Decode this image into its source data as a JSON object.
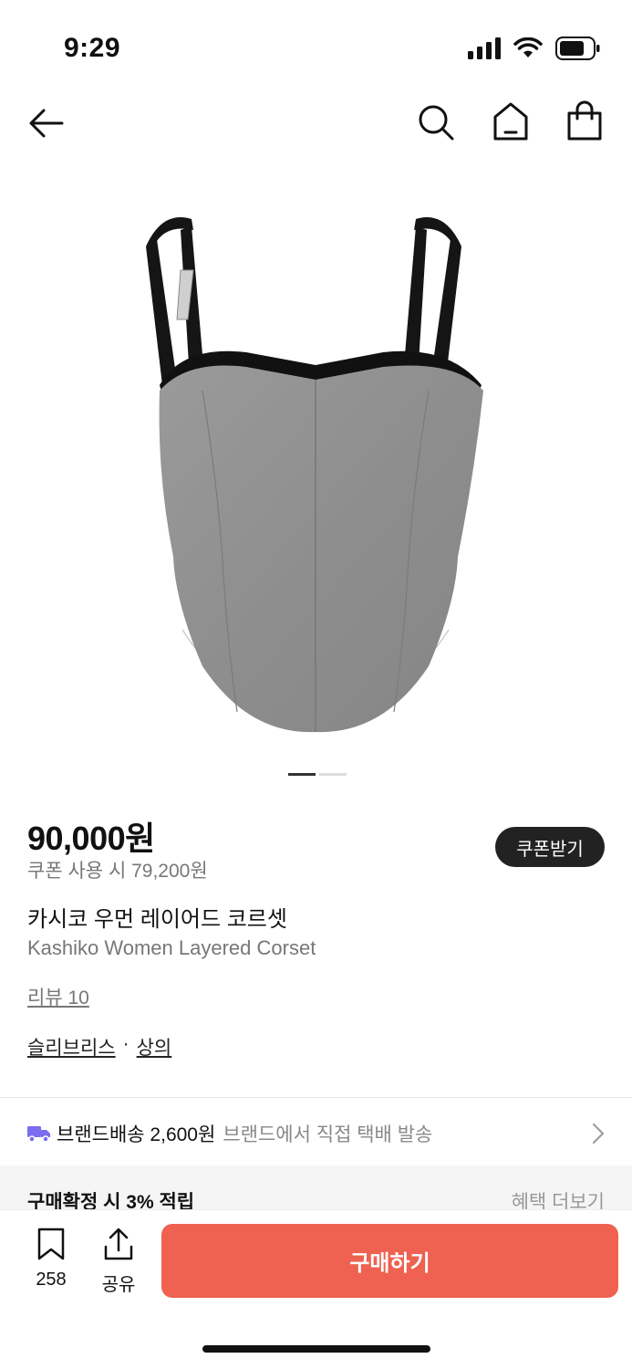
{
  "status": {
    "time": "9:29"
  },
  "nav": {
    "back_icon": "arrow-left-icon",
    "search_icon": "search-icon",
    "home_icon": "home-icon",
    "bag_icon": "shopping-bag-icon"
  },
  "gallery": {
    "page_count": 2,
    "active_index": 0
  },
  "product": {
    "price": "90,000원",
    "coupon_price": "쿠폰 사용 시 79,200원",
    "coupon_button": "쿠폰받기",
    "name_ko": "카시코 우먼 레이어드 코르셋",
    "name_en": "Kashiko Women Layered Corset",
    "review": "리뷰 10",
    "brand": "슬리브리스",
    "separator": "·",
    "category": "상의"
  },
  "shipping": {
    "label": "브랜드배송 2,600원",
    "detail": "브랜드에서 직접 택배 발송",
    "icon": "truck-icon"
  },
  "benefit": {
    "title": "구매확정 시 3% 적립",
    "more": "혜택 더보기"
  },
  "bottom": {
    "save_count": "258",
    "share_label": "공유",
    "buy_label": "구매하기"
  },
  "colors": {
    "accent": "#ef6150",
    "shipping_icon": "#7b6cf0",
    "dark": "#222222"
  }
}
